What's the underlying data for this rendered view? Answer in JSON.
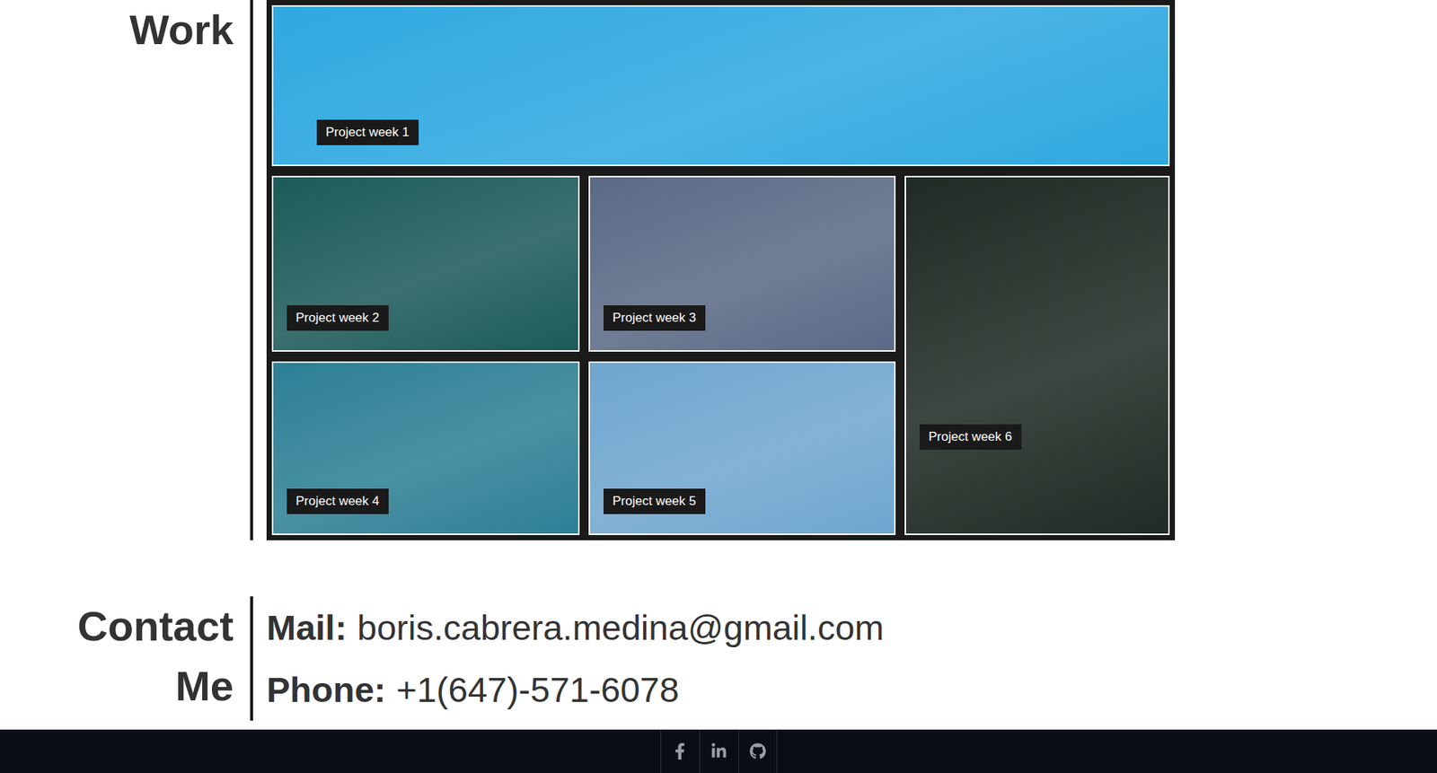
{
  "work": {
    "title": "Work",
    "projects": [
      {
        "label": "Project week 1",
        "color": "#2fa8e0"
      },
      {
        "label": "Project week 2",
        "color": "#1c5a5a"
      },
      {
        "label": "Project week 3",
        "color": "#5a6a86"
      },
      {
        "label": "Project week 4",
        "color": "#2d7f95"
      },
      {
        "label": "Project week 5",
        "color": "#6fa6cf"
      },
      {
        "label": "Project week 6",
        "color": "#1f2b24"
      }
    ]
  },
  "contact": {
    "title": "Contact Me",
    "items": [
      {
        "label": "Mail:",
        "value": "boris.cabrera.medina@gmail.com"
      },
      {
        "label": "Phone:",
        "value": "+1(647)-571-6078"
      }
    ]
  },
  "footer": {
    "links": [
      {
        "kind": "facebook"
      },
      {
        "kind": "linkedin"
      },
      {
        "kind": "github"
      }
    ]
  }
}
